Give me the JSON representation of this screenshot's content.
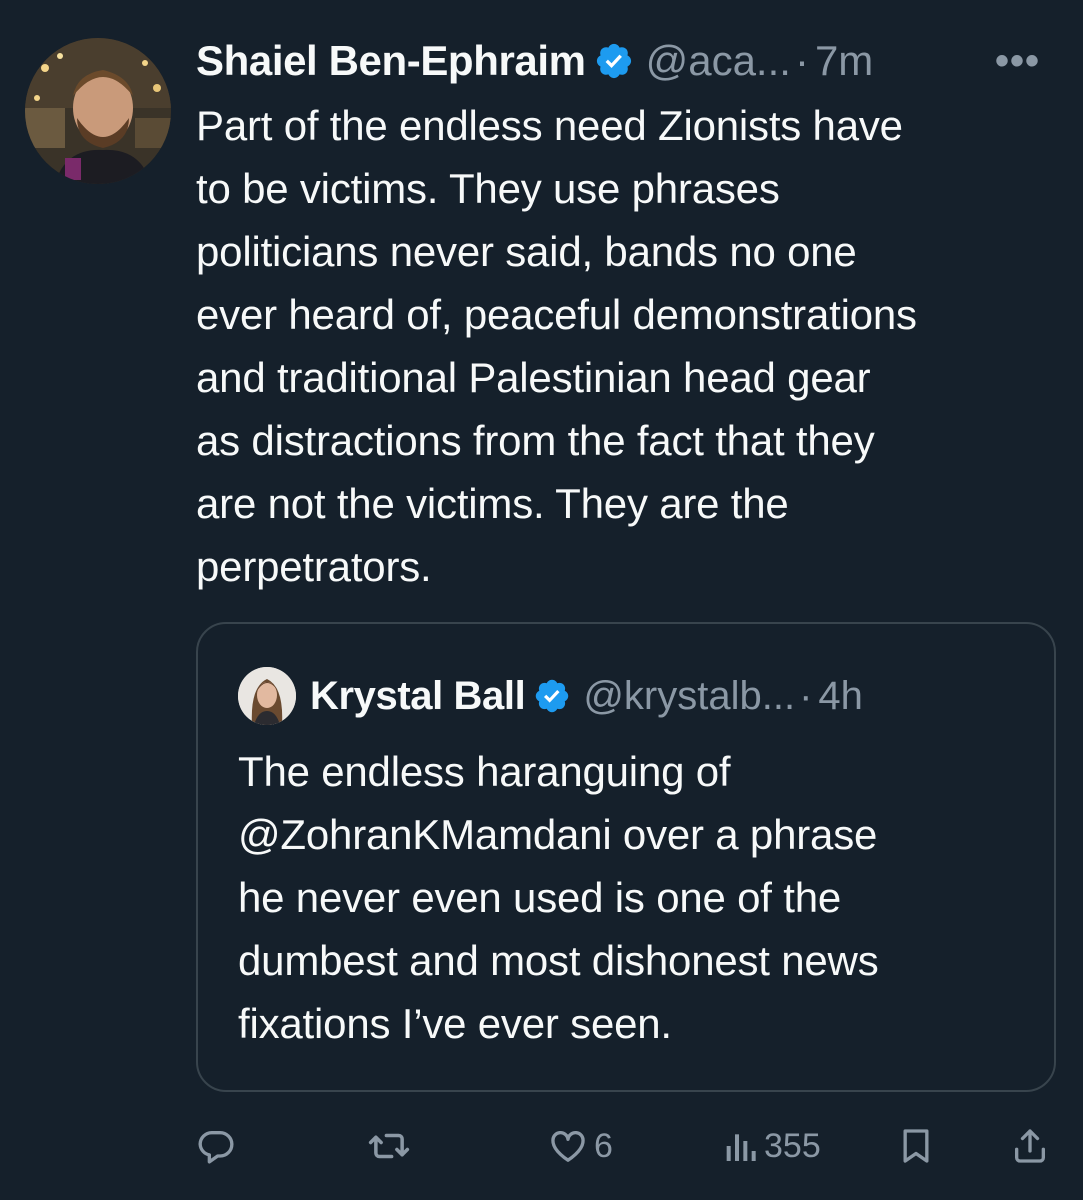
{
  "tweet": {
    "author_name": "Shaiel Ben-Ephraim",
    "handle": "@aca...",
    "separator": "·",
    "time": "7m",
    "more_label": "•••",
    "text": "Part of the endless need Zionists have\nto be victims. They use phrases\npoliticians never said, bands no one\never heard of, peaceful demonstrations\nand traditional Palestinian head gear\nas distractions from the fact that they\nare not the victims. They are the\nperpetrators."
  },
  "quoted": {
    "author_name": "Krystal Ball",
    "handle": "@krystalb...",
    "separator": "·",
    "time": "4h",
    "text": "The endless haranguing of\n@ZohranKMamdani over a phrase\nhe never even used is one of the\ndumbest and most dishonest news\nfixations I’ve ever seen."
  },
  "actions": {
    "reply_count": "",
    "retweet_count": "",
    "like_count": "6",
    "views_count": "355"
  },
  "colors": {
    "background": "#15202b",
    "text": "#f7f9f9",
    "muted": "#8b98a5",
    "verified": "#1d9bf0",
    "border": "#38444d"
  },
  "icons": {
    "verified": "verified-badge-icon",
    "reply": "reply-icon",
    "retweet": "retweet-icon",
    "like": "heart-icon",
    "views": "views-chart-icon",
    "bookmark": "bookmark-icon",
    "share": "share-icon"
  }
}
